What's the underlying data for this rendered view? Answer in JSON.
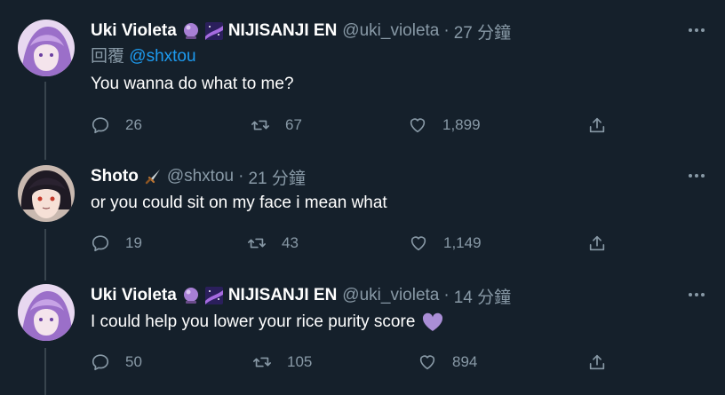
{
  "tweets": [
    {
      "name": "Uki Violeta",
      "org": "NIJISANJI EN",
      "handle": "@uki_violeta",
      "dot": "·",
      "time": "27 分鐘",
      "reply_prefix": "回覆",
      "reply_to": "@shxtou",
      "text": "You wanna do what to me?",
      "replies": "26",
      "retweets": "67",
      "likes": "1,899",
      "avatar_color": "#b48ed8"
    },
    {
      "name": "Shoto",
      "handle": "@shxtou",
      "dot": "·",
      "time": "21 分鐘",
      "text": "or you could sit on my face i mean what",
      "replies": "19",
      "retweets": "43",
      "likes": "1,149",
      "avatar_color": "#3a2a2a"
    },
    {
      "name": "Uki Violeta",
      "org": "NIJISANJI EN",
      "handle": "@uki_violeta",
      "dot": "·",
      "time": "14 分鐘",
      "text": "I could help you lower your rice purity score",
      "replies": "50",
      "retweets": "105",
      "likes": "894",
      "avatar_color": "#b48ed8"
    }
  ],
  "icons": {
    "reply": "reply-icon",
    "retweet": "retweet-icon",
    "like": "heart-icon",
    "share": "share-icon",
    "more": "more-icon"
  },
  "colors": {
    "background": "#15202b",
    "secondary_text": "#8899a6",
    "link": "#1d9bf0",
    "thread_line": "#38444d"
  }
}
